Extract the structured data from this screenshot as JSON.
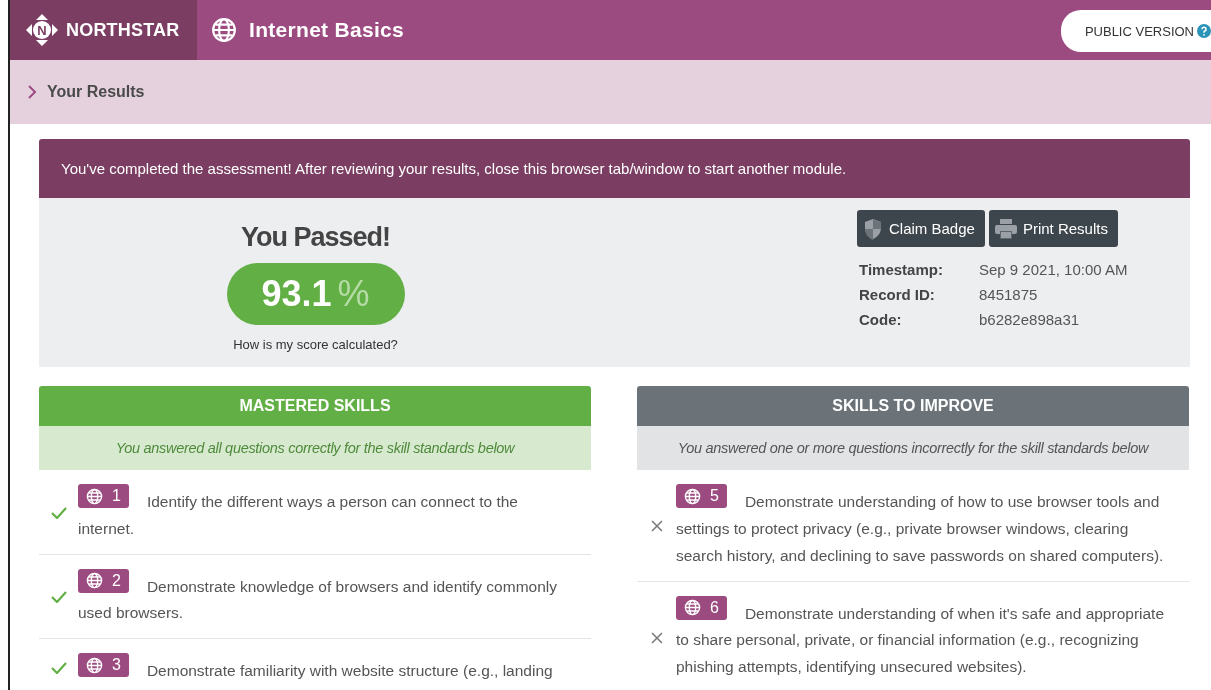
{
  "header": {
    "logo": {
      "mark": "N",
      "name": "NORTHSTAR"
    },
    "module": "Internet Basics",
    "version_button": "PUBLIC VERSION"
  },
  "breadcrumb": {
    "label": "Your Results"
  },
  "notice": "You've completed the assessment! After reviewing your results, close this browser tab/window to start another module.",
  "result": {
    "heading": "You Passed!",
    "score": "93.1",
    "unit": "%",
    "score_link": "How is my score calculated?",
    "buttons": [
      {
        "kind": "badge",
        "label": "Claim Badge"
      },
      {
        "kind": "print",
        "label": "Print Results"
      }
    ],
    "details": [
      {
        "label": "Timestamp:",
        "value": "Sep 9 2021, 10:00 AM"
      },
      {
        "label": "Record ID:",
        "value": "8451875"
      },
      {
        "label": "Code:",
        "value": "b6282e898a31"
      }
    ]
  },
  "columns": [
    {
      "kind": "mastered",
      "title": "MASTERED SKILLS",
      "subtitle": "You answered all questions correctly for the skill standards below",
      "skills": [
        {
          "number": "1",
          "text": "Identify the different ways a person can connect to the internet."
        },
        {
          "number": "2",
          "text": "Demonstrate knowledge of browsers and identify commonly used browsers."
        },
        {
          "number": "3",
          "text": "Demonstrate familiarity with website structure (e.g., landing"
        }
      ]
    },
    {
      "kind": "improve",
      "title": "SKILLS TO IMPROVE",
      "subtitle": "You answered one or more questions incorrectly for the skill standards below",
      "skills": [
        {
          "number": "5",
          "text": "Demonstrate understanding of how to use browser tools and settings to protect privacy (e.g., private browser windows, clearing search history, and declining to save passwords on shared computers)."
        },
        {
          "number": "6",
          "text": "Demonstrate understanding of when it's safe and appropriate to share personal, private, or financial information (e.g., recognizing phishing attempts, identifying unsecured websites)."
        }
      ]
    }
  ]
}
